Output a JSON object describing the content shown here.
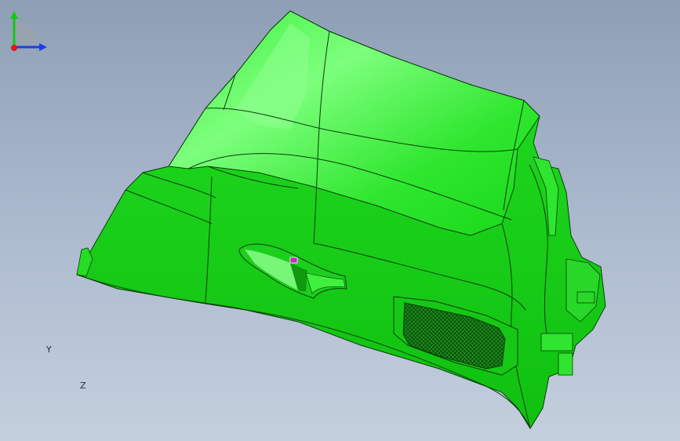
{
  "viewport": {
    "background_top": "#8e9fb5",
    "background_bottom": "#c4cfdd"
  },
  "model": {
    "color": "#19e619",
    "highlight": "#6cff6c",
    "shade": "#0fbf0f",
    "edge_color": "#0b3d0b",
    "selection_color": "#cc22cc"
  },
  "triad": {
    "y_label": "Y",
    "z_label": "Z",
    "y_color": "#14c814",
    "z_color": "#1a3ee8",
    "x_color": "#e01818"
  }
}
